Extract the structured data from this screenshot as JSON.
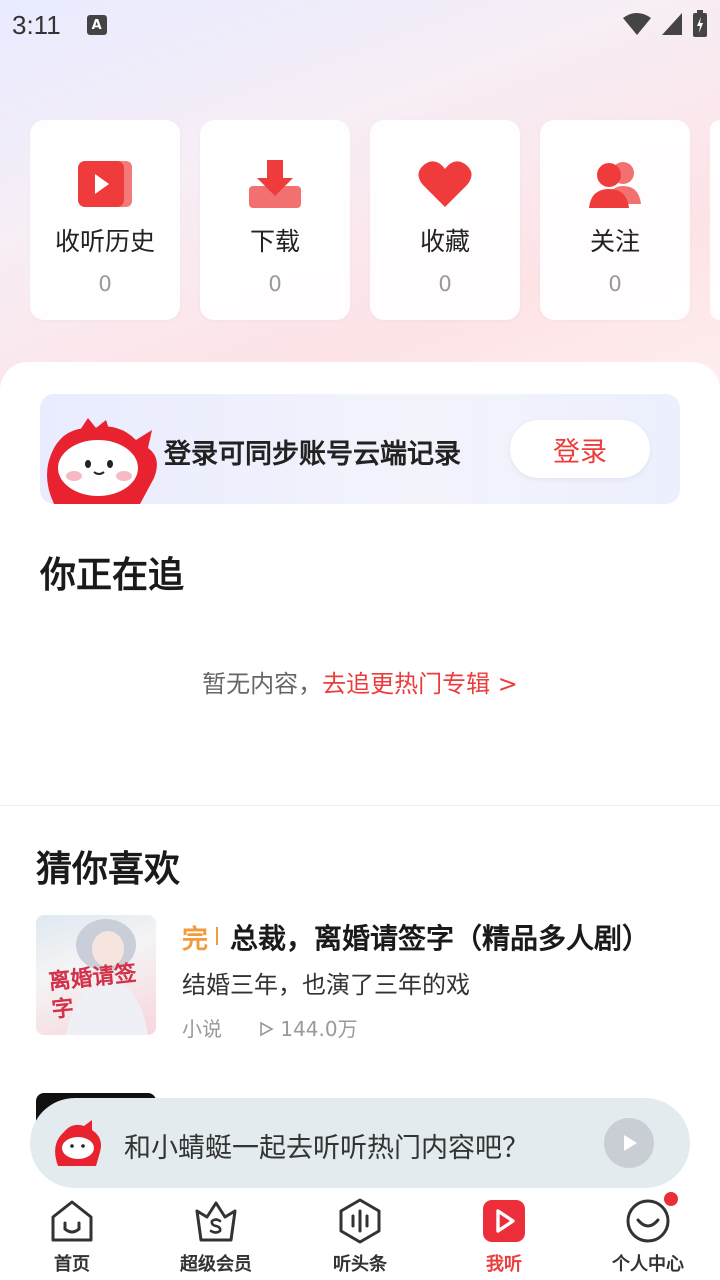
{
  "status_bar": {
    "time": "3:11",
    "notif_letter": "A"
  },
  "quick_access": [
    {
      "label": "收听历史",
      "count": "0",
      "icon": "play-history-icon"
    },
    {
      "label": "下载",
      "count": "0",
      "icon": "download-icon"
    },
    {
      "label": "收藏",
      "count": "0",
      "icon": "heart-icon"
    },
    {
      "label": "关注",
      "count": "0",
      "icon": "follow-users-icon"
    }
  ],
  "login_banner": {
    "text": "登录可同步账号云端记录",
    "button": "登录"
  },
  "following": {
    "title": "你正在追",
    "empty_text": "暂无内容，",
    "empty_link": "去追更热门专辑 >"
  },
  "recommend": {
    "title": "猜你喜欢",
    "items": [
      {
        "badge": "完",
        "title": "总裁，离婚请签字（精品多人剧）",
        "desc": "结婚三年，也演了三年的戏",
        "category": "小说",
        "plays": "144.0万",
        "cover_text": "离婚请签字"
      }
    ]
  },
  "mini_player": {
    "text": "和小蜻蜓一起去听听热门内容吧？"
  },
  "tabs": [
    {
      "label": "首页",
      "icon": "home-icon"
    },
    {
      "label": "超级会员",
      "icon": "vip-crown-icon"
    },
    {
      "label": "听头条",
      "icon": "headline-icon"
    },
    {
      "label": "我听",
      "icon": "my-listen-icon",
      "active": true
    },
    {
      "label": "个人中心",
      "icon": "profile-icon"
    }
  ],
  "colors": {
    "accent": "#ec3c3c",
    "badge": "#f19a3e"
  }
}
